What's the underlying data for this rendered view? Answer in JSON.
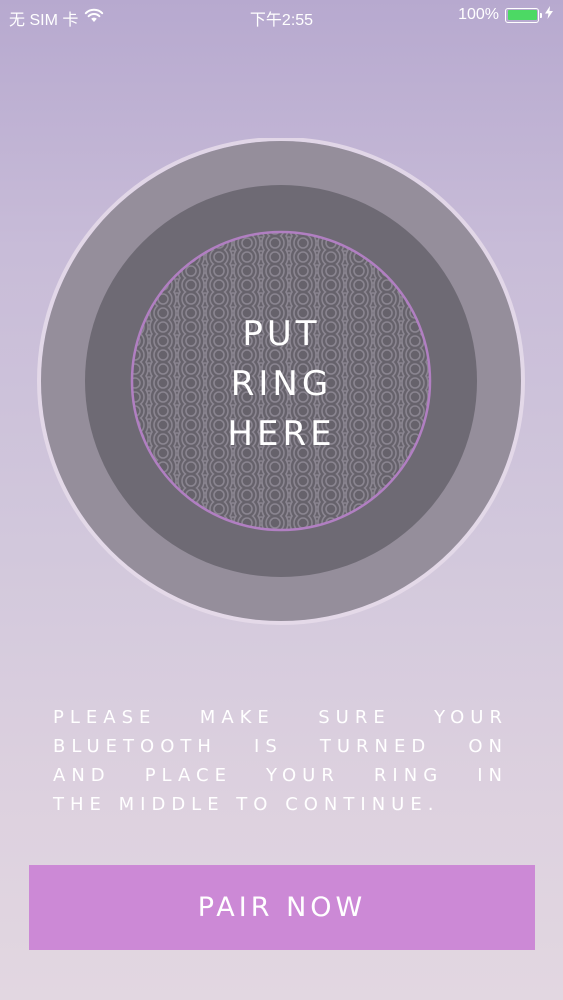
{
  "status_bar": {
    "carrier": "无 SIM 卡",
    "time": "下午2:55",
    "battery_percent_text": "100%",
    "battery_level": 1.0,
    "battery_color": "#4cd964",
    "wifi_icon": "wifi-icon",
    "charging_icon": "lightning-bolt-icon"
  },
  "pad": {
    "label_lines": [
      "PUT",
      "RING",
      "HERE"
    ],
    "pattern_icon": "seigaiha-wave-pattern",
    "outer_ring_color": "#958e9b",
    "middle_ring_color": "#6e6a74",
    "accent_ring_color": "#b17fc2"
  },
  "instructions": {
    "lines": [
      "PLEASE MAKE SURE YOUR",
      "BLUETOOTH IS TURNED ON",
      "AND PLACE YOUR RING IN",
      "THE MIDDLE TO CONTINUE."
    ]
  },
  "pair_button": {
    "label": "PAIR NOW",
    "color": "#cc89d6"
  }
}
